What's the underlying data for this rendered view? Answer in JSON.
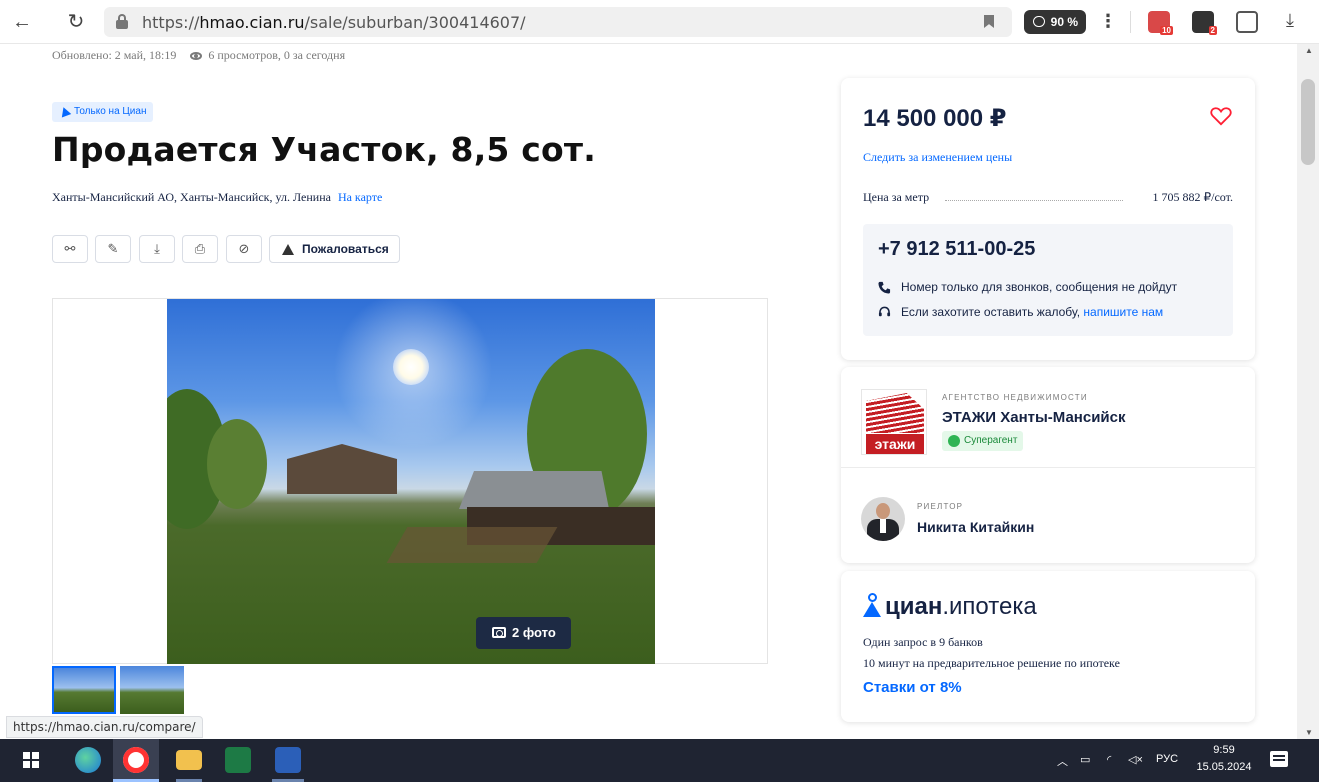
{
  "browser": {
    "url_prefix": "https://",
    "url_host": "hmao.cian.ru",
    "url_path": "/sale/suburban/300414607/",
    "zoom": "90 %",
    "ext_badges": [
      "10",
      "2"
    ]
  },
  "listing": {
    "meta": "Обновлено: 2 май, 18:19",
    "views": "6 просмотров, 0 за сегодня",
    "only_cian": "Только на Циан",
    "title": "Продается Участок, 8,5 сот.",
    "address": "Ханты-Мансийский АО, Ханты-Мансийск, ул. Ленина",
    "map_link": "На карте",
    "report_label": "Пожаловаться",
    "photo_count": "2 фото"
  },
  "status_url": "https://hmao.cian.ru/compare/",
  "price_card": {
    "price": "14 500 000 ₽",
    "watch_link": "Следить за изменением цены",
    "ppm_label": "Цена за метр",
    "ppm_value": "1 705 882 ₽/сот.",
    "phone": "+7 912 511-00-25",
    "note_calls": "Номер только для звонков, сообщения не дойдут",
    "note_complaint": "Если захотите оставить жалобу,",
    "note_complaint_link": "напишите нам"
  },
  "agency": {
    "caption": "АГЕНТСТВО НЕДВИЖИМОСТИ",
    "name": "ЭТАЖИ Ханты-Мансийск",
    "logo_word": "этажи",
    "badge": "Суперагент",
    "realtor_caption": "РИЕЛТОР",
    "realtor_name": "Никита Китайкин"
  },
  "mortgage": {
    "brand_bold": "циан",
    "brand_rest": ".ипотека",
    "line1": "Один запрос в 9 банков",
    "line2": "10 минут на предварительное решение по ипотеке",
    "rates": "Ставки от 8%"
  },
  "taskbar": {
    "lang": "РУС",
    "time": "9:59",
    "date": "15.05.2024"
  },
  "colors": {
    "accent": "#0468ff",
    "text": "#152242",
    "brand_red": "#c41e23",
    "heart": "#ff1f34"
  }
}
